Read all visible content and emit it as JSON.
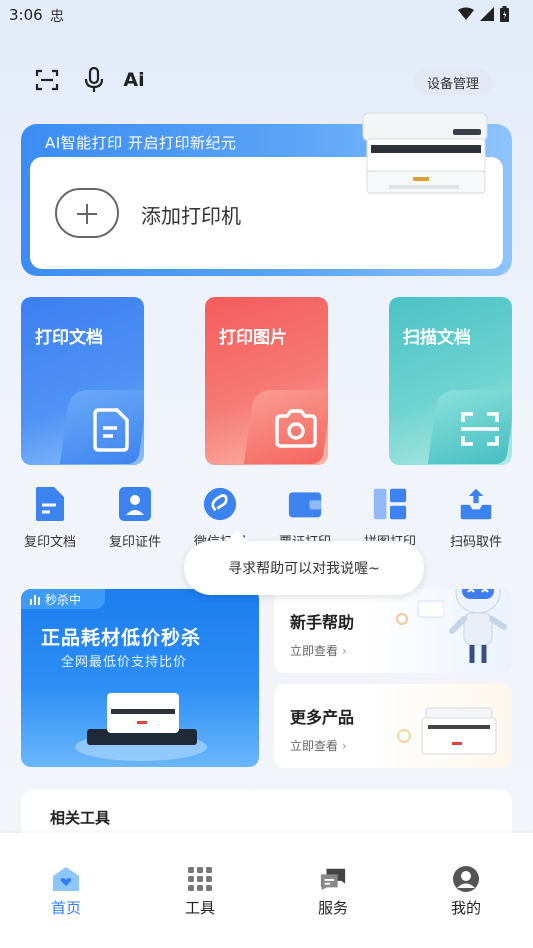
{
  "status_bar": {
    "time": "3:06",
    "notif_glyph": "忠"
  },
  "top_bar": {
    "ai_label": "Ai",
    "device_manage": "设备管理"
  },
  "banner": {
    "slogan": "AI智能打印  开启打印新纪元",
    "add_printer": "添加打印机"
  },
  "features": [
    {
      "label": "打印文档",
      "color": "#3b86f0"
    },
    {
      "label": "打印图片",
      "color": "#f06a6a"
    },
    {
      "label": "扫描文档",
      "color": "#4fc6c6"
    }
  ],
  "tools": [
    {
      "label": "复印文档"
    },
    {
      "label": "复印证件"
    },
    {
      "label": "微信打印"
    },
    {
      "label": "票证打印"
    },
    {
      "label": "拼图打印"
    },
    {
      "label": "扫码取件"
    }
  ],
  "assistant_bubble": "寻求帮助可以对我说喔~",
  "promo": {
    "tag": "秒杀中",
    "title_a": "正品耗材",
    "title_b": "低价秒杀",
    "subtitle": "全网最低价支持比价"
  },
  "help_card": {
    "title": "新手帮助",
    "link": "立即查看"
  },
  "more_card": {
    "title": "更多产品",
    "link": "立即查看"
  },
  "related_tools": {
    "title": "相关工具"
  },
  "tabbar": [
    {
      "label": "首页",
      "active": true
    },
    {
      "label": "工具",
      "active": false
    },
    {
      "label": "服务",
      "active": false
    },
    {
      "label": "我的",
      "active": false
    }
  ],
  "colors": {
    "accent": "#2f7ff2",
    "print_doc": "#3b86f0",
    "print_photo": "#f06a6a",
    "scan_doc": "#4fc6c6"
  }
}
